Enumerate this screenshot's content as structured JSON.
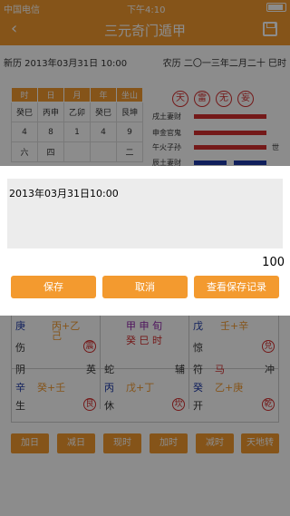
{
  "status_bar": {
    "carrier": "中国电信",
    "time": "下午4:10"
  },
  "header": {
    "title": "三元奇门遁甲"
  },
  "dates": {
    "solar": "新历  2013年03月31日  10:00",
    "lunar": "农历  二〇一三年二月二十  巳时"
  },
  "pillars": {
    "headers": [
      "时",
      "日",
      "月",
      "年",
      "坐山"
    ],
    "rows": [
      [
        "癸巳",
        "丙申",
        "乙卯",
        "癸巳",
        "艮坤"
      ],
      [
        "4",
        "8",
        "1",
        "4",
        "9"
      ],
      [
        "六",
        "四",
        "",
        "",
        "二"
      ]
    ]
  },
  "circles": [
    "天",
    "雷",
    "无",
    "妄"
  ],
  "yao": [
    {
      "label": "戌土妻财",
      "shi": ""
    },
    {
      "label": "申金官鬼",
      "shi": ""
    },
    {
      "label": "午火子孙",
      "shi": "世"
    },
    {
      "label": "辰土妻财",
      "shi": ""
    }
  ],
  "palace": {
    "c1": {
      "top": [
        "庚",
        "丙+乙",
        ""
      ],
      "sub": "己",
      "bottom": [
        "伤",
        "",
        "震"
      ]
    },
    "c2": {
      "top": [
        "甲  申  旬",
        "",
        ""
      ],
      "sub": "癸  巳  时",
      "bottom": [
        "",
        "",
        ""
      ]
    },
    "c3": {
      "top": [
        "戊",
        "壬+辛",
        ""
      ],
      "sub": "",
      "bottom": [
        "惊",
        "",
        "兑"
      ]
    },
    "c4": {
      "top": [
        "阴",
        "",
        "英"
      ],
      "mid": [
        "辛",
        "癸+壬",
        ""
      ],
      "bottom": [
        "生",
        "",
        "艮"
      ]
    },
    "c5": {
      "top": [
        "蛇",
        "",
        "辅"
      ],
      "mid": [
        "丙",
        "戊+丁",
        ""
      ],
      "bottom": [
        "休",
        "",
        "坎"
      ]
    },
    "c6": {
      "top": [
        "符",
        "马",
        "冲"
      ],
      "mid": [
        "癸",
        "乙+庚",
        ""
      ],
      "bottom": [
        "开",
        "",
        "乾"
      ]
    }
  },
  "bottom_buttons": [
    "加日",
    "减日",
    "现时",
    "加时",
    "减时",
    "天地转"
  ],
  "dialog": {
    "text": "2013年03月31日10:00",
    "count": "100",
    "save_label": "保存",
    "cancel_label": "取消",
    "view_label": "查看保存记录"
  },
  "colors": {
    "accent": "#f39a2f",
    "red": "#d32f2f",
    "blue": "#1e3aa8"
  }
}
